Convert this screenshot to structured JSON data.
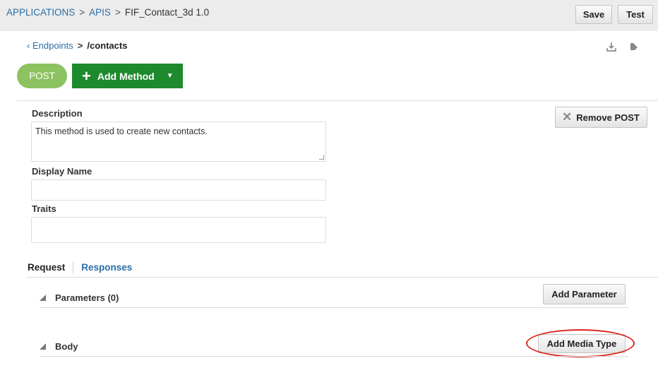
{
  "breadcrumb": {
    "items": [
      "APPLICATIONS",
      "APIS"
    ],
    "current": "FIF_Contact_3d  1.0",
    "separator": ">"
  },
  "toolbar": {
    "save_label": "Save",
    "test_label": "Test"
  },
  "endpoint": {
    "back_label": "Endpoints",
    "separator": ">",
    "path": "/contacts",
    "icons": [
      "download-icon",
      "edit-icon"
    ]
  },
  "method": {
    "current": "POST",
    "add_method_label": "Add Method",
    "remove_label": "Remove POST"
  },
  "form": {
    "description_label": "Description",
    "description_value": "This method is used to create new contacts.",
    "display_name_label": "Display Name",
    "display_name_value": "",
    "traits_label": "Traits",
    "traits_value": ""
  },
  "tabs": {
    "request": "Request",
    "responses": "Responses"
  },
  "sections": {
    "parameters_title": "Parameters (0)",
    "add_parameter_label": "Add Parameter",
    "body_title": "Body",
    "add_media_type_label": "Add Media Type"
  },
  "colors": {
    "link": "#2a6ea6",
    "post_pill": "#8cc25f",
    "add_method": "#1e8a2e",
    "highlight_ring": "#d9261c"
  }
}
